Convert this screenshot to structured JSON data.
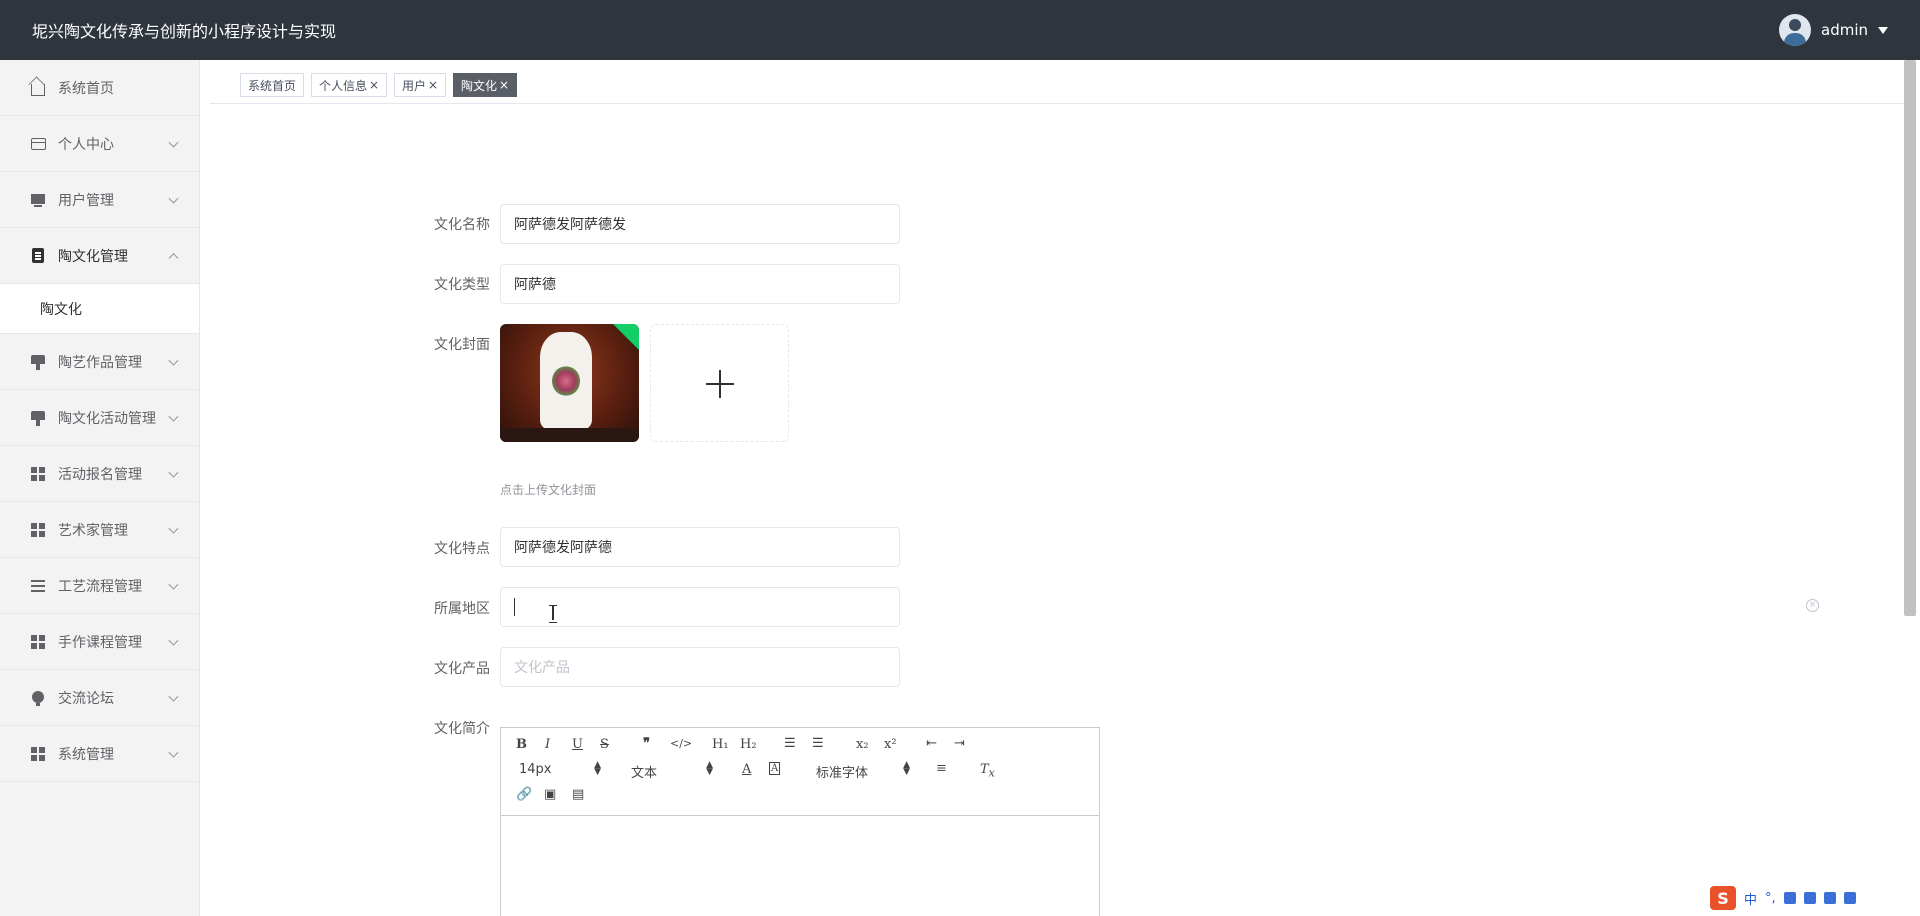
{
  "header": {
    "title": "坭兴陶文化传承与创新的小程序设计与实现",
    "username": "admin"
  },
  "sidebar": {
    "items": [
      {
        "label": "系统首页",
        "icon": "home-icon"
      },
      {
        "label": "个人中心",
        "icon": "card-icon"
      },
      {
        "label": "用户管理",
        "icon": "monitor-icon"
      },
      {
        "label": "陶文化管理",
        "icon": "clipboard-icon",
        "expanded": true
      },
      {
        "label": "陶艺作品管理",
        "icon": "brush-icon"
      },
      {
        "label": "陶文化活动管理",
        "icon": "brush-icon"
      },
      {
        "label": "活动报名管理",
        "icon": "grid-icon"
      },
      {
        "label": "艺术家管理",
        "icon": "grid-icon"
      },
      {
        "label": "工艺流程管理",
        "icon": "lines-icon"
      },
      {
        "label": "手作课程管理",
        "icon": "grid-icon"
      },
      {
        "label": "交流论坛",
        "icon": "bulb-icon"
      },
      {
        "label": "系统管理",
        "icon": "grid-icon"
      }
    ],
    "subitem": "陶文化"
  },
  "tabs": [
    {
      "label": "系统首页",
      "close": ""
    },
    {
      "label": "个人信息",
      "close": "×"
    },
    {
      "label": "用户",
      "close": "×"
    },
    {
      "label": "陶文化",
      "close": "×",
      "active": true
    }
  ],
  "form": {
    "name": {
      "label": "文化名称",
      "value": "阿萨德发阿萨德发"
    },
    "type": {
      "label": "文化类型",
      "value": "阿萨德"
    },
    "cover": {
      "label": "文化封面",
      "hint": "点击上传文化封面"
    },
    "feature": {
      "label": "文化特点",
      "value": "阿萨德发阿萨德"
    },
    "region": {
      "label": "所属地区",
      "value": ""
    },
    "product": {
      "label": "文化产品",
      "placeholder": "文化产品"
    },
    "intro": {
      "label": "文化简介"
    }
  },
  "editor": {
    "font_size": "14px",
    "block_type": "文本",
    "font_family": "标准字体"
  },
  "ime": {
    "lang": "中",
    "punct": "°,"
  }
}
